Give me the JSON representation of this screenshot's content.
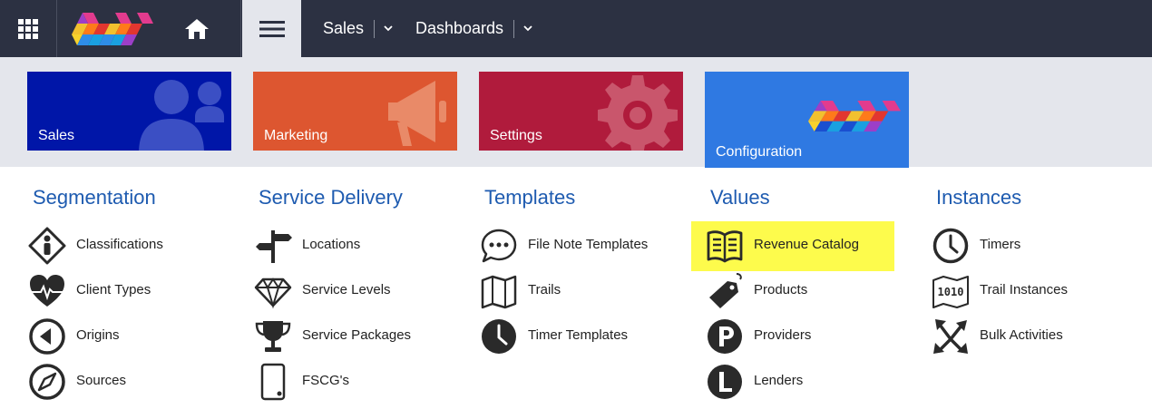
{
  "topbar": {
    "nav": [
      {
        "label": "Sales"
      },
      {
        "label": "Dashboards"
      }
    ]
  },
  "tiles": [
    {
      "label": "Sales",
      "color": "#0016a8"
    },
    {
      "label": "Marketing",
      "color": "#dd5630"
    },
    {
      "label": "Settings",
      "color": "#b01b3c"
    },
    {
      "label": "Configuration",
      "color": "#2f79e2",
      "selected": true
    }
  ],
  "columns": [
    {
      "title": "Segmentation",
      "items": [
        {
          "label": "Classifications",
          "icon": "classification-icon"
        },
        {
          "label": "Client Types",
          "icon": "heart-pulse-icon"
        },
        {
          "label": "Origins",
          "icon": "origin-icon"
        },
        {
          "label": "Sources",
          "icon": "compass-icon"
        }
      ]
    },
    {
      "title": "Service Delivery",
      "items": [
        {
          "label": "Locations",
          "icon": "signpost-icon"
        },
        {
          "label": "Service Levels",
          "icon": "diamond-icon"
        },
        {
          "label": "Service Packages",
          "icon": "trophy-icon"
        },
        {
          "label": "FSCG's",
          "icon": "tablet-icon"
        }
      ]
    },
    {
      "title": "Templates",
      "items": [
        {
          "label": "File Note Templates",
          "icon": "chat-bubble-icon"
        },
        {
          "label": "Trails",
          "icon": "map-icon"
        },
        {
          "label": "Timer Templates",
          "icon": "clock-icon"
        }
      ]
    },
    {
      "title": "Values",
      "items": [
        {
          "label": "Revenue Catalog",
          "icon": "catalog-book-icon",
          "highlighted": true
        },
        {
          "label": "Products",
          "icon": "price-tag-icon"
        },
        {
          "label": "Providers",
          "icon": "letter-p-icon"
        },
        {
          "label": "Lenders",
          "icon": "letter-l-icon"
        }
      ]
    },
    {
      "title": "Instances",
      "items": [
        {
          "label": "Timers",
          "icon": "clock-outline-icon"
        },
        {
          "label": "Trail Instances",
          "icon": "binary-map-icon"
        },
        {
          "label": "Bulk Activities",
          "icon": "arrows-out-icon"
        }
      ]
    }
  ],
  "colors": {
    "topbar": "#2c3142",
    "band": "#e4e6ec",
    "heading": "#1e5bb0",
    "highlight": "#fdfb4c"
  }
}
